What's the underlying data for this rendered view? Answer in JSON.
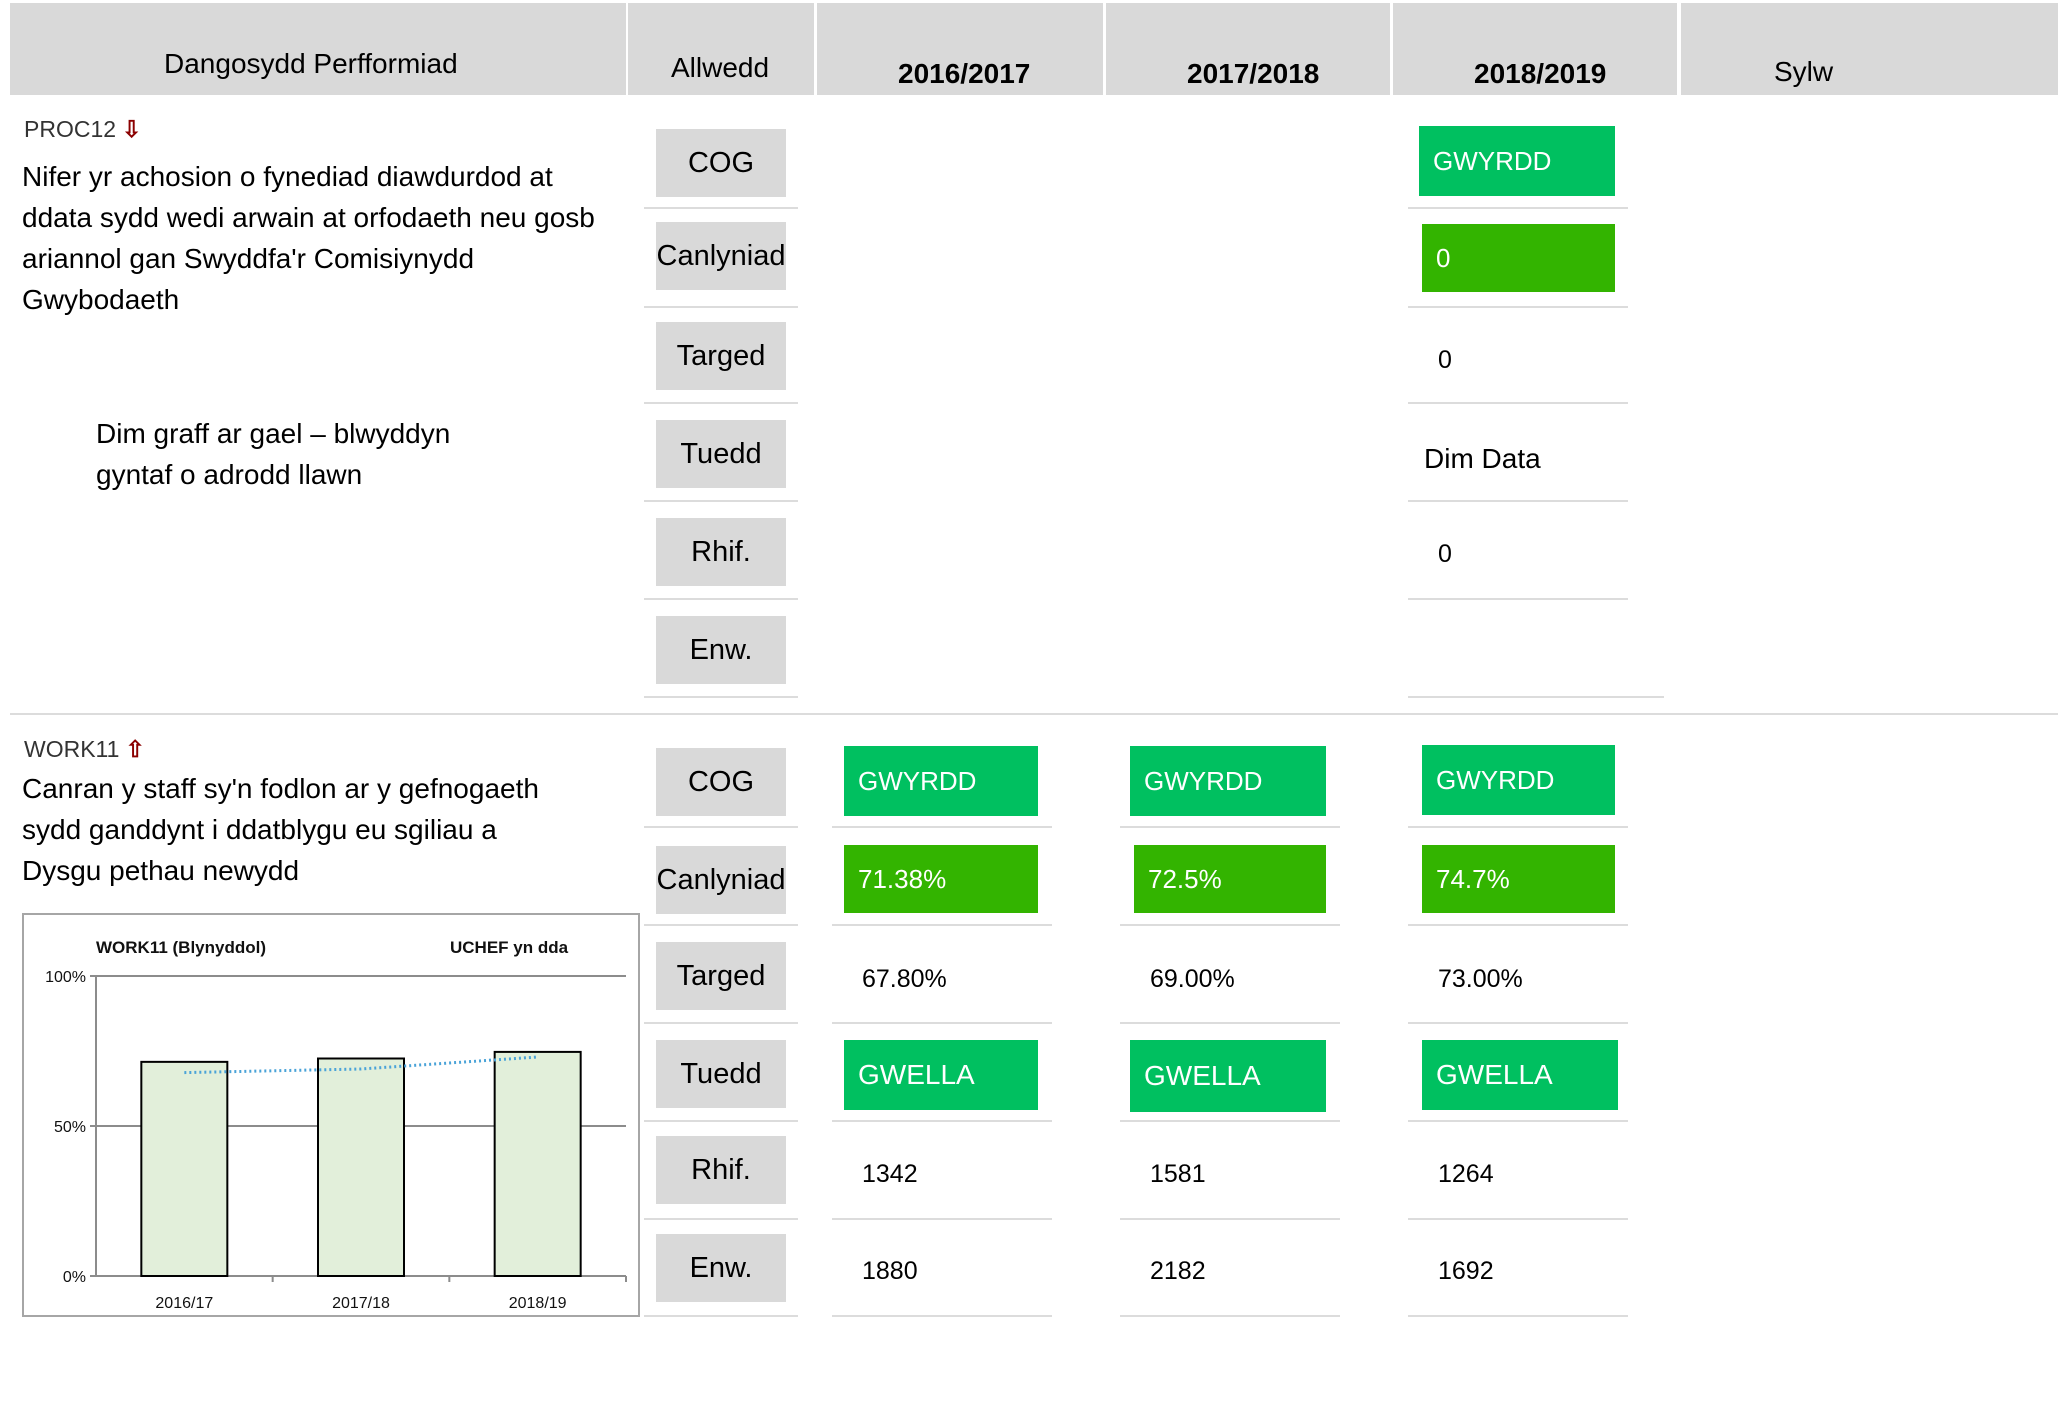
{
  "header": {
    "indicator": "Dangosydd Perfformiad",
    "key": "Allwedd",
    "year1": "2016/2017",
    "year2": "2017/2018",
    "year3": "2018/2019",
    "comment": "Sylw"
  },
  "keys": [
    "COG",
    "Canlyniad",
    "Targed",
    "Tuedd",
    "Rhif.",
    "Enw."
  ],
  "proc12": {
    "code": "PROC12",
    "arrow": "⇩",
    "description": "Nifer yr achosion o fynediad diawdurdod at ddata sydd wedi arwain at orfodaeth neu gosb ariannol gan Swyddfa'r Comisiynydd Gwybodaeth",
    "note": "Dim graff ar gael – blwyddyn gyntaf o adrodd llawn",
    "y2018": {
      "cog": "GWYRDD",
      "result": "0",
      "target": "0",
      "trend": "Dim Data",
      "num": "0",
      "den": ""
    }
  },
  "work11": {
    "code": "WORK11",
    "arrow": "⇧",
    "description": "Canran y staff sy'n fodlon ar y gefnogaeth sydd ganddynt i ddatblygu eu sgiliau a Dysgu pethau newydd",
    "years": [
      {
        "cog": "GWYRDD",
        "result": "71.38%",
        "target": "67.80%",
        "trend": "GWELLA",
        "num": "1342",
        "den": "1880"
      },
      {
        "cog": "GWYRDD",
        "result": "72.5%",
        "target": "69.00%",
        "trend": "GWELLA",
        "num": "1581",
        "den": "2182"
      },
      {
        "cog": "GWYRDD",
        "result": "74.7%",
        "target": "73.00%",
        "trend": "GWELLA",
        "num": "1264",
        "den": "1692"
      }
    ]
  },
  "colors": {
    "green_cog": "#00c060",
    "green_result": "#33b400",
    "bar_fill": "#e2efda",
    "trend_line": "#4aa3d8",
    "header_bg": "#d9d9d9"
  },
  "chart_data": {
    "type": "bar",
    "title": "WORK11 (Blynyddol)",
    "subtitle": "UCHEF yn dda",
    "categories": [
      "2016/17",
      "2017/18",
      "2018/19"
    ],
    "values": [
      71.38,
      72.5,
      74.7
    ],
    "trend": [
      67.8,
      69.0,
      73.0
    ],
    "yticks": [
      "0%",
      "50%",
      "100%"
    ],
    "ylim": [
      0,
      100
    ],
    "grid": true
  }
}
